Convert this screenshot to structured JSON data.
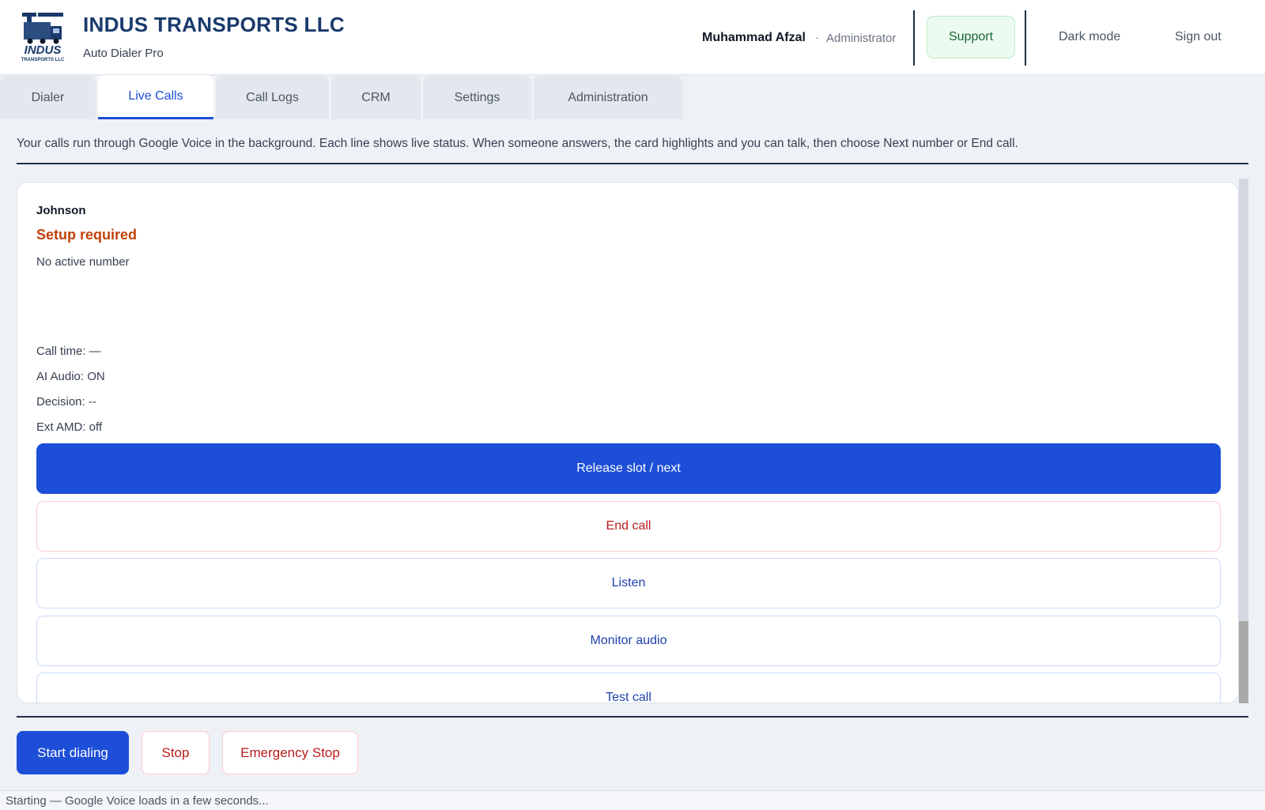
{
  "header": {
    "logo_text": "INDUS",
    "logo_subtext": "TRANSPORTS LLC",
    "title": "INDUS TRANSPORTS LLC",
    "subtitle": "Auto Dialer Pro",
    "user_name": "Muhammad Afzal",
    "separator": "·",
    "user_role": "Administrator",
    "support_label": "Support",
    "dark_mode_label": "Dark mode",
    "sign_out_label": "Sign out"
  },
  "tabs": [
    {
      "label": "Dialer"
    },
    {
      "label": "Live Calls",
      "active": true
    },
    {
      "label": "Call Logs"
    },
    {
      "label": "CRM"
    },
    {
      "label": "Settings"
    },
    {
      "label": "Administration"
    }
  ],
  "info_text": "Your calls run through Google Voice in the background. Each line shows live status. When someone answers, the card highlights and you can talk, then choose Next number or End call.",
  "line": {
    "name": "Johnson",
    "status": "Setup required",
    "number": "No active number",
    "call_time": "Call time: —",
    "ai_audio": "AI Audio: ON",
    "decision": "Decision: --",
    "ext_amd": "Ext AMD: off",
    "actions": {
      "release": "Release slot / next",
      "end": "End call",
      "listen": "Listen",
      "monitor": "Monitor audio",
      "test": "Test call"
    }
  },
  "controls": {
    "start": "Start dialing",
    "stop": "Stop",
    "emergency": "Emergency Stop"
  },
  "status_bar": "Starting — Google Voice loads in a few seconds...",
  "colors": {
    "brand_navy": "#1a3a6b",
    "primary_blue": "#1d4ed8",
    "danger_red": "#b91c1c",
    "warning_orange": "#c2410c",
    "support_green": "#166534"
  }
}
